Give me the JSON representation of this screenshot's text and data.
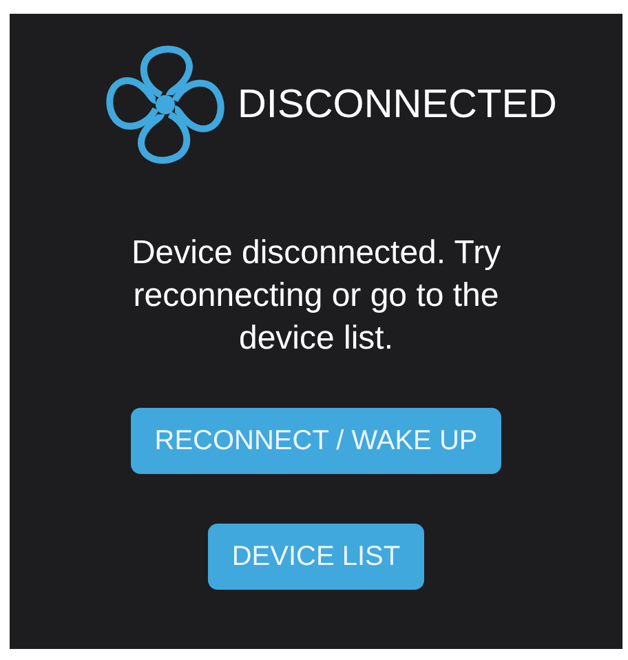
{
  "header": {
    "title": "DISCONNECTED"
  },
  "message": "Device disconnected. Try reconnecting or go to the device list.",
  "buttons": [
    {
      "label": "RECONNECT / WAKE UP"
    },
    {
      "label": "DEVICE LIST"
    }
  ]
}
